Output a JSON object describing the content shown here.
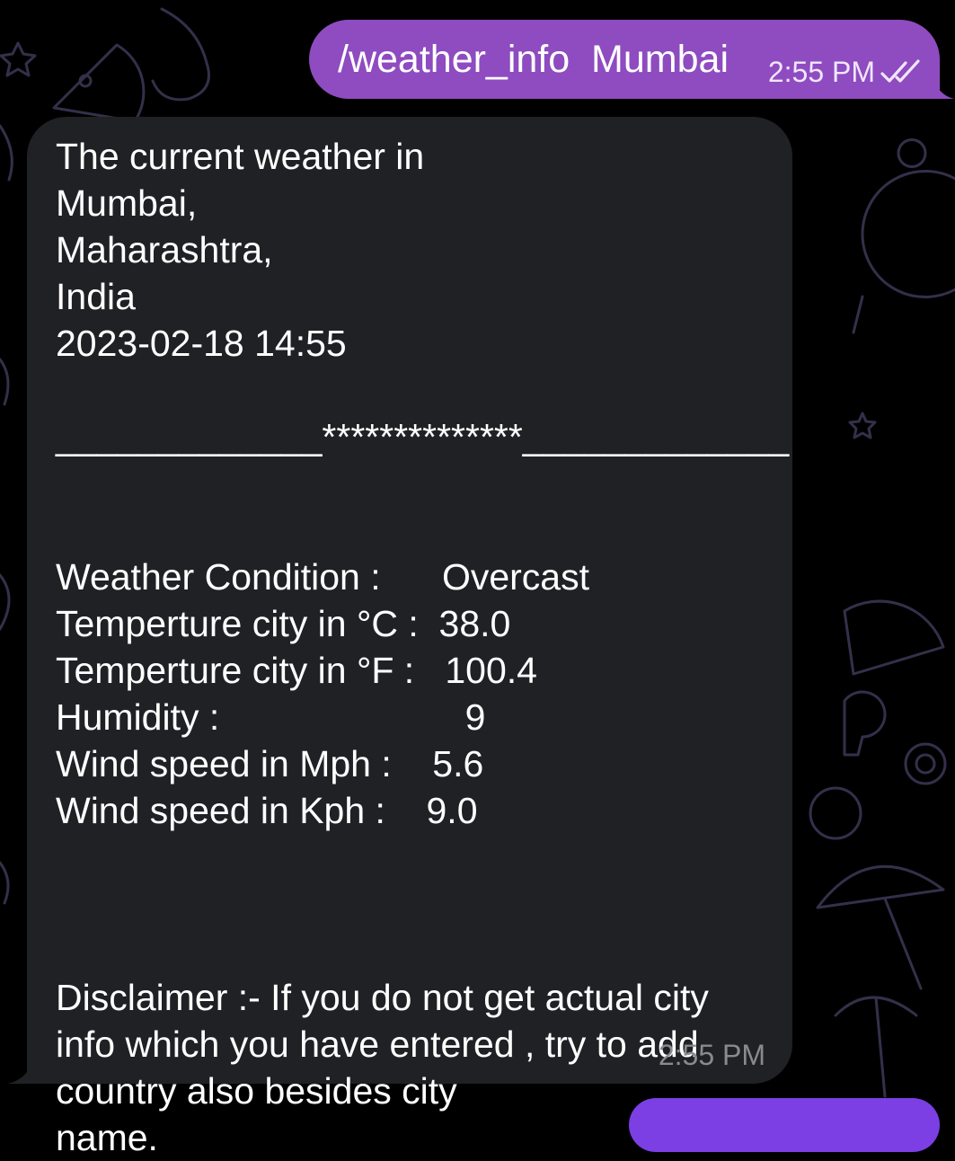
{
  "chat": {
    "outgoing_message": {
      "text": "/weather_info  Mumbai",
      "time": "2:55 PM",
      "status_icon": "double-check-icon"
    },
    "incoming_message": {
      "lines": [
        "The current weather in",
        "Mumbai,",
        "Maharashtra,",
        "India",
        "2023-02-18 14:55",
        "",
        "_____________**************_____________",
        "",
        "",
        "Weather Condition :      Overcast",
        "Temperture city in °C :  38.0",
        "Temperture city in °F :   100.4",
        "Humidity :                        9",
        "Wind speed in Mph :    5.6",
        "Wind speed in Kph :    9.0",
        "",
        "",
        "",
        "Disclaimer :- If you do not get actual city",
        "info which you have entered , try to add",
        "country also besides city",
        "name."
      ],
      "time": "2:55 PM"
    }
  },
  "colors": {
    "background": "#000000",
    "outgoing_bubble": "#8e4cc0",
    "incoming_bubble": "#202124",
    "incoming_time": "#8a8a8d",
    "wallpaper_doodle": "#3a3550"
  }
}
